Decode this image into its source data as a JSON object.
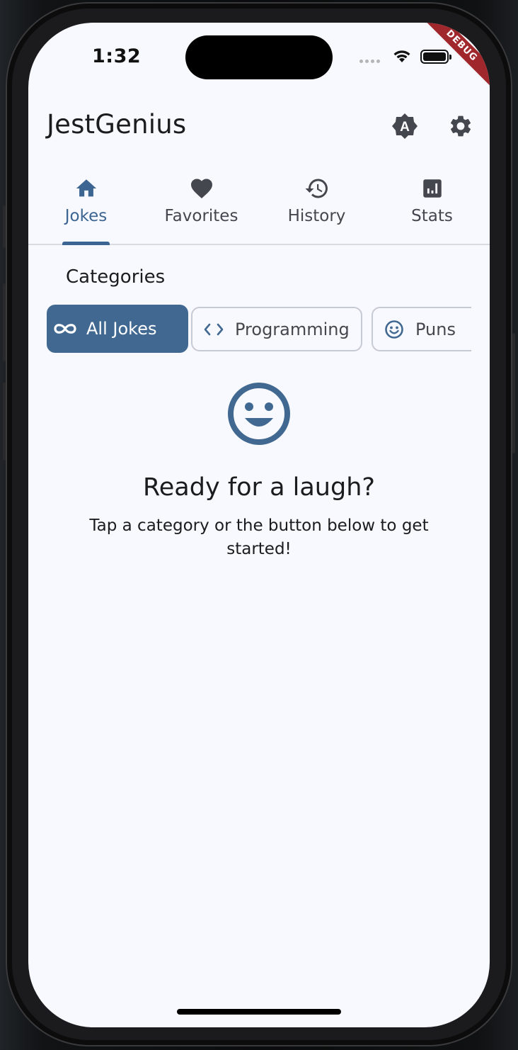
{
  "status_bar": {
    "time": "1:32"
  },
  "debug_banner": "DEBUG",
  "app_bar": {
    "title": "JestGenius",
    "actions": [
      {
        "name": "theme-badge-icon",
        "glyph": "A"
      },
      {
        "name": "gear-icon"
      }
    ]
  },
  "tabs": [
    {
      "label": "Jokes",
      "icon": "home-icon",
      "active": true
    },
    {
      "label": "Favorites",
      "icon": "heart-icon",
      "active": false
    },
    {
      "label": "History",
      "icon": "history-icon",
      "active": false
    },
    {
      "label": "Stats",
      "icon": "bar-chart-icon",
      "active": false
    }
  ],
  "categories": {
    "title": "Categories",
    "chips": [
      {
        "label": "All Jokes",
        "icon": "infinity-icon",
        "selected": true
      },
      {
        "label": "Programming",
        "icon": "code-icon",
        "selected": false
      },
      {
        "label": "Puns",
        "icon": "smiley-icon",
        "selected": false
      }
    ]
  },
  "empty_state": {
    "icon": "smiley-face-icon",
    "title": "Ready for a laugh?",
    "subtitle": "Tap a category or the button below to get started!"
  },
  "colors": {
    "primary": "#406891",
    "background": "#f8f9fe",
    "text": "#1a1c1e",
    "icon": "#44474e"
  }
}
